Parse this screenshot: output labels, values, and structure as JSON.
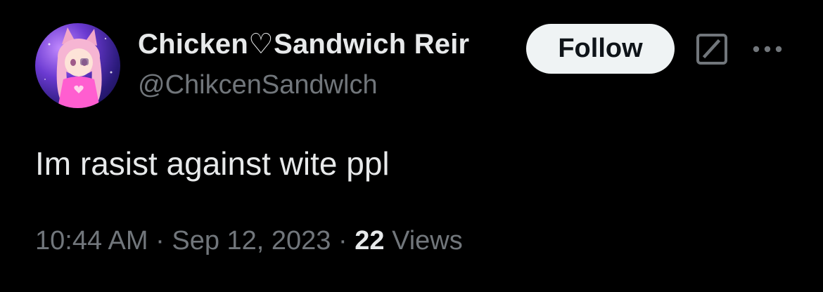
{
  "user": {
    "name_part1": "Chicken",
    "name_heart": "♡",
    "name_part2": "Sandwich Reir",
    "handle": "@ChikcenSandwlch"
  },
  "actions": {
    "follow_label": "Follow"
  },
  "icons": {
    "grok": "grok-icon",
    "more": "more-icon"
  },
  "tweet": {
    "text": "Im rasist against wite ppl",
    "time": "10:44 AM",
    "separator": "·",
    "date": "Sep 12, 2023",
    "views_count": "22",
    "views_label": "Views"
  },
  "colors": {
    "background": "#000000",
    "text_primary": "#e7e9ea",
    "text_secondary": "#71767b",
    "button_bg": "#eff3f4",
    "button_text": "#0f1419"
  }
}
